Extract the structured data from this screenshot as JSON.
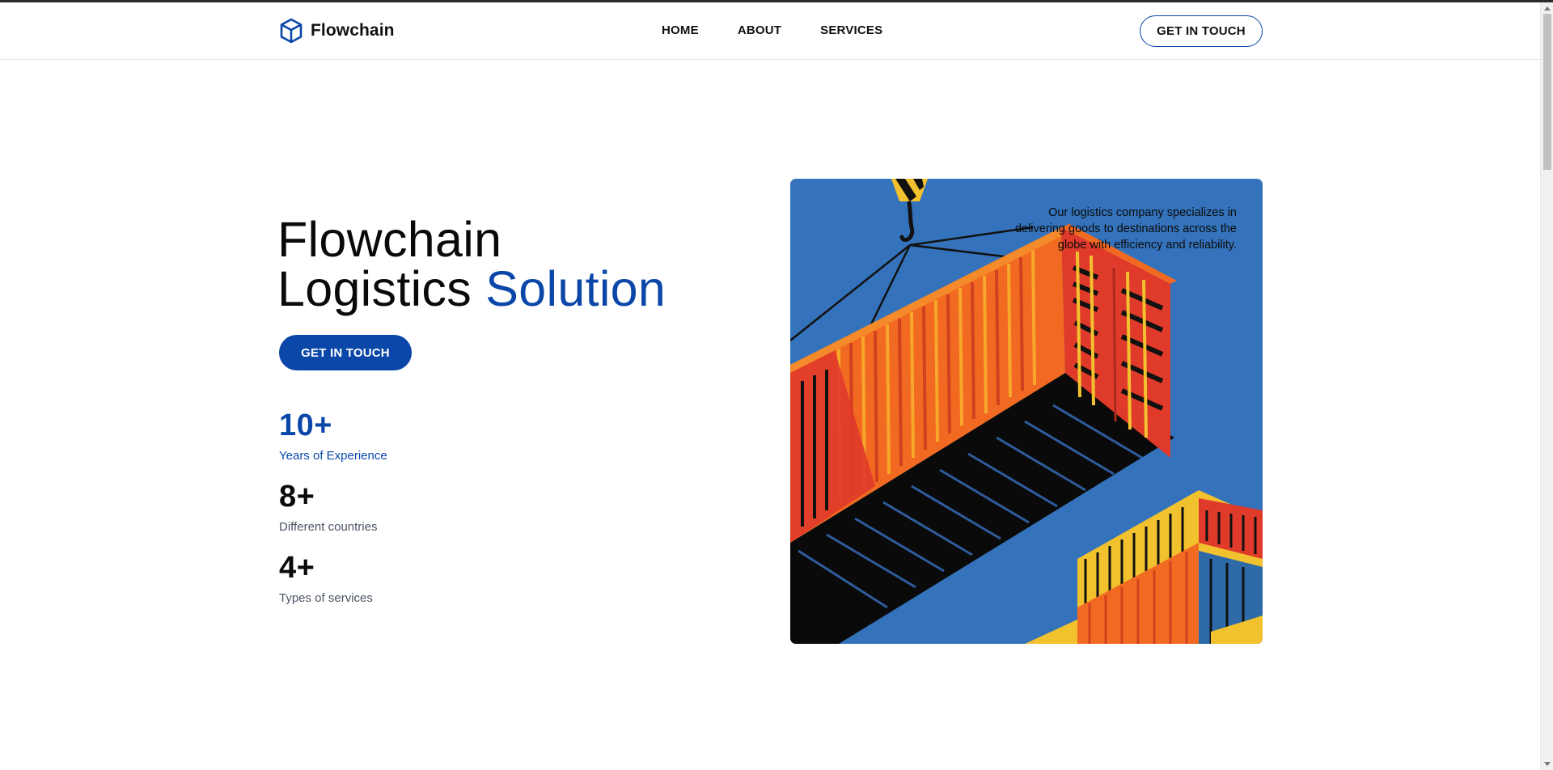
{
  "header": {
    "brand": "Flowchain",
    "nav": [
      "HOME",
      "ABOUT",
      "SERVICES"
    ],
    "cta_label": "GET IN TOUCH"
  },
  "hero": {
    "title_line1": "Flowchain",
    "title_line2_plain": "Logistics ",
    "title_line2_accent": "Solution",
    "cta_label": "GET IN TOUCH",
    "stats": [
      {
        "value": "10+",
        "label": "Years of Experience"
      },
      {
        "value": "8+",
        "label": "Different countries"
      },
      {
        "value": "4+",
        "label": "Types of services"
      }
    ],
    "blurb": "Our logistics company specializes in delivering goods to destinations across the globe with efficiency and reliability."
  },
  "colors": {
    "accent": "#0a47a9",
    "image_background": "#3473bb",
    "container_orange": "#f26a21",
    "container_red": "#e03a2a",
    "container_yellow": "#f2c12e"
  },
  "icons": {
    "brand": "cube-icon"
  }
}
